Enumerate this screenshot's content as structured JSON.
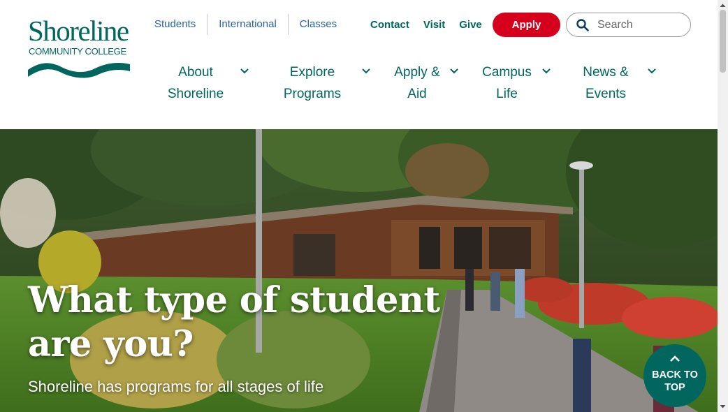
{
  "logo": {
    "name": "Shoreline",
    "subtitle": "COMMUNITY COLLEGE"
  },
  "utility_nav": {
    "audience_links": [
      "Students",
      "International",
      "Classes"
    ],
    "quick_links": [
      "Contact",
      "Visit",
      "Give"
    ],
    "apply_label": "Apply"
  },
  "search": {
    "placeholder": "Search",
    "value": ""
  },
  "main_nav": [
    {
      "line1": "About",
      "line2": "Shoreline"
    },
    {
      "line1": "Explore",
      "line2": "Programs"
    },
    {
      "line1": "Apply &",
      "line2": "Aid"
    },
    {
      "line1": "Campus",
      "line2": "Life"
    },
    {
      "line1": "News &",
      "line2": "Events"
    }
  ],
  "hero": {
    "title_line1": "What type of student",
    "title_line2": "are you?",
    "subtitle": "Shoreline has programs for all stages of life"
  },
  "back_to_top": {
    "line1": "BACK TO",
    "line2": "TOP"
  },
  "colors": {
    "brand_green": "#00665e",
    "apply_red": "#d6001c",
    "link_blue": "#2a62a5"
  }
}
